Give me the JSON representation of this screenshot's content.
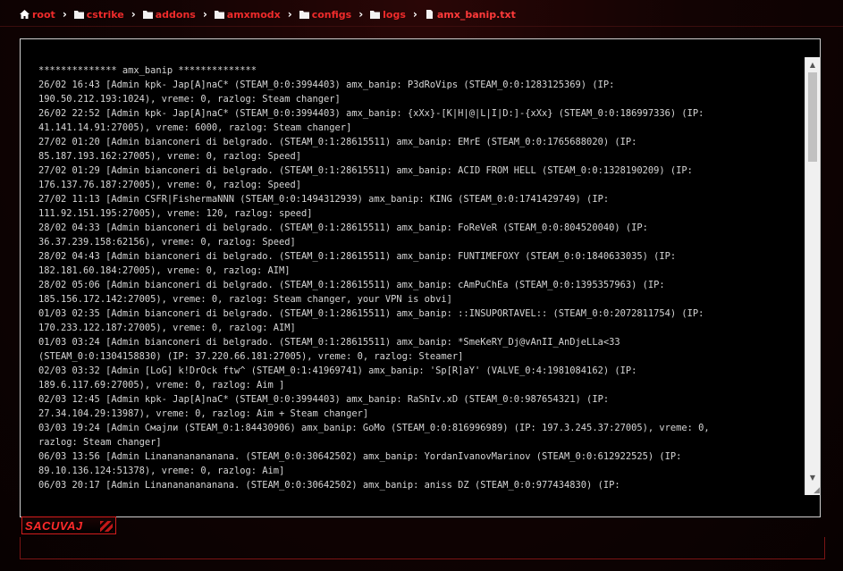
{
  "breadcrumb": [
    {
      "label": "root",
      "icon": "home-icon"
    },
    {
      "label": "cstrike",
      "icon": "folder-icon"
    },
    {
      "label": "addons",
      "icon": "folder-icon"
    },
    {
      "label": "amxmodx",
      "icon": "folder-icon"
    },
    {
      "label": "configs",
      "icon": "folder-icon"
    },
    {
      "label": "logs",
      "icon": "folder-icon"
    },
    {
      "label": "amx_banip.txt",
      "icon": "file-icon"
    }
  ],
  "editor": {
    "lines": [
      "************** amx_banip **************",
      "26/02 16:43 [Admin kpk- Jap[A]naC* (STEAM_0:0:3994403) amx_banip: P3dRoVips (STEAM_0:0:1283125369) (IP:",
      "190.50.212.193:1024), vreme: 0, razlog: Steam changer]",
      "26/02 22:52 [Admin kpk- Jap[A]naC* (STEAM_0:0:3994403) amx_banip: {xXx}-[K|H|@|L|I|D:]-{xXx} (STEAM_0:0:186997336) (IP:",
      "41.141.14.91:27005), vreme: 6000, razlog: Steam changer]",
      "27/02 01:20 [Admin bianconeri di belgrado. (STEAM_0:1:28615511) amx_banip: EMrE (STEAM_0:0:1765688020) (IP:",
      "85.187.193.162:27005), vreme: 0, razlog: Speed]",
      "27/02 01:29 [Admin bianconeri di belgrado. (STEAM_0:1:28615511) amx_banip: ACID FROM HELL (STEAM_0:0:1328190209) (IP:",
      "176.137.76.187:27005), vreme: 0, razlog: Speed]",
      "27/02 11:13 [Admin CSFR|FishermaNNN (STEAM_0:0:1494312939) amx_banip: KING (STEAM_0:0:1741429749) (IP:",
      "111.92.151.195:27005), vreme: 120, razlog: speed]",
      "28/02 04:33 [Admin bianconeri di belgrado. (STEAM_0:1:28615511) amx_banip: FoReVeR (STEAM_0:0:804520040) (IP:",
      "36.37.239.158:62156), vreme: 0, razlog: Speed]",
      "28/02 04:43 [Admin bianconeri di belgrado. (STEAM_0:1:28615511) amx_banip: FUNTIMEFOXY (STEAM_0:0:1840633035) (IP:",
      "182.181.60.184:27005), vreme: 0, razlog: AIM]",
      "28/02 05:06 [Admin bianconeri di belgrado. (STEAM_0:1:28615511) amx_banip: cAmPuChEa (STEAM_0:0:1395357963) (IP:",
      "185.156.172.142:27005), vreme: 0, razlog: Steam changer, your VPN is obvi]",
      "01/03 02:35 [Admin bianconeri di belgrado. (STEAM_0:1:28615511) amx_banip: ::INSUPORTAVEL:: (STEAM_0:0:2072811754) (IP:",
      "170.233.122.187:27005), vreme: 0, razlog: AIM]",
      "01/03 03:24 [Admin bianconeri di belgrado. (STEAM_0:1:28615511) amx_banip: *SmeKeRY_Dj@vAnII_AnDjeLLa<33",
      "(STEAM_0:0:1304158830) (IP: 37.220.66.181:27005), vreme: 0, razlog: Steamer]",
      "02/03 03:32 [Admin [LoG] k!DrOck ftw^ (STEAM_0:1:41969741) amx_banip: 'Sp[R]aY' (VALVE_0:4:1981084162) (IP:",
      "189.6.117.69:27005), vreme: 0, razlog: Aim ]",
      "02/03 12:45 [Admin kpk- Jap[A]naC* (STEAM_0:0:3994403) amx_banip: RaShIv.xD (STEAM_0:0:987654321) (IP:",
      "27.34.104.29:13987), vreme: 0, razlog: Aim + Steam changer]",
      "03/03 19:24 [Admin Смајли (STEAM_0:1:84430906) amx_banip: GoMo (STEAM_0:0:816996989) (IP: 197.3.245.37:27005), vreme: 0,",
      "razlog: Steam changer]",
      "06/03 13:56 [Admin Linanananananana. (STEAM_0:0:30642502) amx_banip: YordanIvanovMarinov (STEAM_0:0:612922525) (IP:",
      "89.10.136.124:51378), vreme: 0, razlog: Aim]",
      "06/03 20:17 [Admin Linanananananana. (STEAM_0:0:30642502) amx_banip: aniss DZ (STEAM_0:0:977434830) (IP:"
    ]
  },
  "save_button": {
    "label": "SACUVAJ"
  },
  "colors": {
    "accent": "#ee2b2b",
    "editor_bg": "#000000",
    "editor_text": "#d6d6d6"
  }
}
